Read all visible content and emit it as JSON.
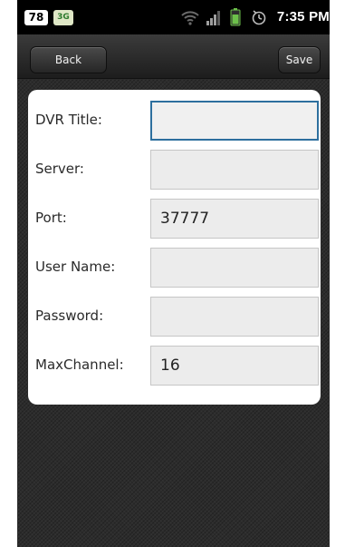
{
  "status_bar": {
    "badge_left": "78",
    "badge_network": "3G",
    "time": "7:35 PM",
    "icons": [
      "wifi-icon",
      "signal-icon",
      "battery-icon",
      "alarm-icon"
    ]
  },
  "toolbar": {
    "back_label": "Back",
    "save_label": "Save"
  },
  "form": {
    "fields": [
      {
        "label": "DVR Title:",
        "value": "",
        "focused": true
      },
      {
        "label": "Server:",
        "value": ""
      },
      {
        "label": "Port:",
        "value": "37777"
      },
      {
        "label": "User Name:",
        "value": ""
      },
      {
        "label": "Password:",
        "value": ""
      },
      {
        "label": "MaxChannel:",
        "value": "16"
      }
    ]
  },
  "colors": {
    "focus_border": "#2d6f9e",
    "input_background": "#ececec",
    "background_dark": "#2c2c2c"
  }
}
